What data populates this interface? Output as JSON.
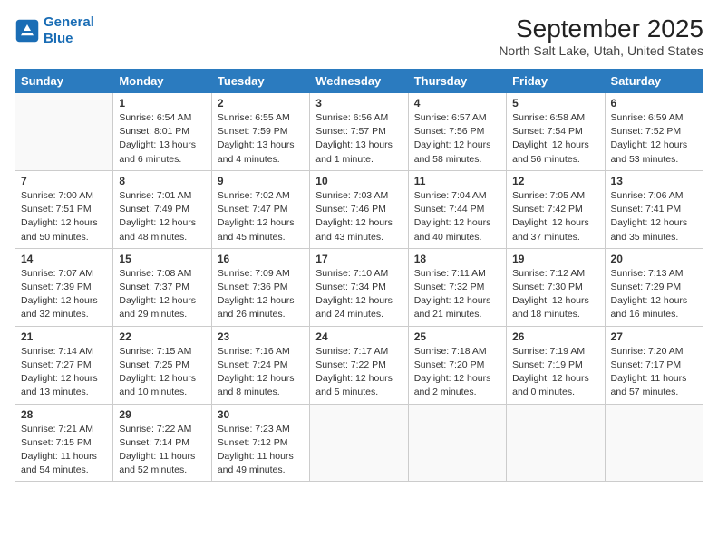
{
  "header": {
    "logo_line1": "General",
    "logo_line2": "Blue",
    "month": "September 2025",
    "location": "North Salt Lake, Utah, United States"
  },
  "weekdays": [
    "Sunday",
    "Monday",
    "Tuesday",
    "Wednesday",
    "Thursday",
    "Friday",
    "Saturday"
  ],
  "weeks": [
    [
      {
        "day": "",
        "info": ""
      },
      {
        "day": "1",
        "info": "Sunrise: 6:54 AM\nSunset: 8:01 PM\nDaylight: 13 hours\nand 6 minutes."
      },
      {
        "day": "2",
        "info": "Sunrise: 6:55 AM\nSunset: 7:59 PM\nDaylight: 13 hours\nand 4 minutes."
      },
      {
        "day": "3",
        "info": "Sunrise: 6:56 AM\nSunset: 7:57 PM\nDaylight: 13 hours\nand 1 minute."
      },
      {
        "day": "4",
        "info": "Sunrise: 6:57 AM\nSunset: 7:56 PM\nDaylight: 12 hours\nand 58 minutes."
      },
      {
        "day": "5",
        "info": "Sunrise: 6:58 AM\nSunset: 7:54 PM\nDaylight: 12 hours\nand 56 minutes."
      },
      {
        "day": "6",
        "info": "Sunrise: 6:59 AM\nSunset: 7:52 PM\nDaylight: 12 hours\nand 53 minutes."
      }
    ],
    [
      {
        "day": "7",
        "info": "Sunrise: 7:00 AM\nSunset: 7:51 PM\nDaylight: 12 hours\nand 50 minutes."
      },
      {
        "day": "8",
        "info": "Sunrise: 7:01 AM\nSunset: 7:49 PM\nDaylight: 12 hours\nand 48 minutes."
      },
      {
        "day": "9",
        "info": "Sunrise: 7:02 AM\nSunset: 7:47 PM\nDaylight: 12 hours\nand 45 minutes."
      },
      {
        "day": "10",
        "info": "Sunrise: 7:03 AM\nSunset: 7:46 PM\nDaylight: 12 hours\nand 43 minutes."
      },
      {
        "day": "11",
        "info": "Sunrise: 7:04 AM\nSunset: 7:44 PM\nDaylight: 12 hours\nand 40 minutes."
      },
      {
        "day": "12",
        "info": "Sunrise: 7:05 AM\nSunset: 7:42 PM\nDaylight: 12 hours\nand 37 minutes."
      },
      {
        "day": "13",
        "info": "Sunrise: 7:06 AM\nSunset: 7:41 PM\nDaylight: 12 hours\nand 35 minutes."
      }
    ],
    [
      {
        "day": "14",
        "info": "Sunrise: 7:07 AM\nSunset: 7:39 PM\nDaylight: 12 hours\nand 32 minutes."
      },
      {
        "day": "15",
        "info": "Sunrise: 7:08 AM\nSunset: 7:37 PM\nDaylight: 12 hours\nand 29 minutes."
      },
      {
        "day": "16",
        "info": "Sunrise: 7:09 AM\nSunset: 7:36 PM\nDaylight: 12 hours\nand 26 minutes."
      },
      {
        "day": "17",
        "info": "Sunrise: 7:10 AM\nSunset: 7:34 PM\nDaylight: 12 hours\nand 24 minutes."
      },
      {
        "day": "18",
        "info": "Sunrise: 7:11 AM\nSunset: 7:32 PM\nDaylight: 12 hours\nand 21 minutes."
      },
      {
        "day": "19",
        "info": "Sunrise: 7:12 AM\nSunset: 7:30 PM\nDaylight: 12 hours\nand 18 minutes."
      },
      {
        "day": "20",
        "info": "Sunrise: 7:13 AM\nSunset: 7:29 PM\nDaylight: 12 hours\nand 16 minutes."
      }
    ],
    [
      {
        "day": "21",
        "info": "Sunrise: 7:14 AM\nSunset: 7:27 PM\nDaylight: 12 hours\nand 13 minutes."
      },
      {
        "day": "22",
        "info": "Sunrise: 7:15 AM\nSunset: 7:25 PM\nDaylight: 12 hours\nand 10 minutes."
      },
      {
        "day": "23",
        "info": "Sunrise: 7:16 AM\nSunset: 7:24 PM\nDaylight: 12 hours\nand 8 minutes."
      },
      {
        "day": "24",
        "info": "Sunrise: 7:17 AM\nSunset: 7:22 PM\nDaylight: 12 hours\nand 5 minutes."
      },
      {
        "day": "25",
        "info": "Sunrise: 7:18 AM\nSunset: 7:20 PM\nDaylight: 12 hours\nand 2 minutes."
      },
      {
        "day": "26",
        "info": "Sunrise: 7:19 AM\nSunset: 7:19 PM\nDaylight: 12 hours\nand 0 minutes."
      },
      {
        "day": "27",
        "info": "Sunrise: 7:20 AM\nSunset: 7:17 PM\nDaylight: 11 hours\nand 57 minutes."
      }
    ],
    [
      {
        "day": "28",
        "info": "Sunrise: 7:21 AM\nSunset: 7:15 PM\nDaylight: 11 hours\nand 54 minutes."
      },
      {
        "day": "29",
        "info": "Sunrise: 7:22 AM\nSunset: 7:14 PM\nDaylight: 11 hours\nand 52 minutes."
      },
      {
        "day": "30",
        "info": "Sunrise: 7:23 AM\nSunset: 7:12 PM\nDaylight: 11 hours\nand 49 minutes."
      },
      {
        "day": "",
        "info": ""
      },
      {
        "day": "",
        "info": ""
      },
      {
        "day": "",
        "info": ""
      },
      {
        "day": "",
        "info": ""
      }
    ]
  ]
}
